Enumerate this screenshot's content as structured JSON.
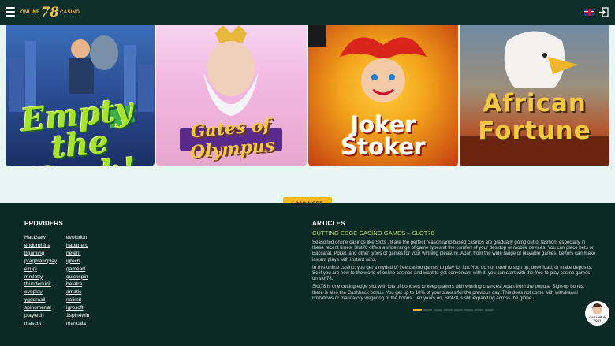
{
  "header": {
    "logo_prefix": "ONLINE",
    "logo_number": "78",
    "logo_suffix": "CASINO"
  },
  "games": [
    {
      "title": "Empty the Bank!"
    },
    {
      "title": "Gates of Olympus"
    },
    {
      "title": "Joker Stoker"
    },
    {
      "title": "African Fortune"
    }
  ],
  "load_more_label": "LOAD MORE",
  "providers": {
    "title": "PROVIDERS",
    "column1": [
      "Hacksaw",
      "endorphina",
      "bgaming",
      "pragmaticplay",
      "ezugi",
      "mrslotty",
      "thunderkick",
      "evoplay",
      "yggdrasil",
      "spinomenal",
      "playtech",
      "mascot"
    ],
    "column2": [
      "evolution",
      "habanero",
      "netent",
      "igtech",
      "gameart",
      "quickspin",
      "belatra",
      "amatic",
      "nolimit",
      "igrosoft",
      "1spin4win",
      "mancala"
    ]
  },
  "articles": {
    "title": "ARTICLES",
    "subtitle": "CUTTING EDGE CASINO GAMES – SLOT78",
    "paragraphs": [
      "Seasoned online casinos like Slots 78 are the perfect reason land-based casinos are gradually going out of fashion, especially in these recent times. Slot78 offers a wide range of game types at the comfort of your desktop or mobile devices. You can place bets on Baccarat, Poker, and other types of games for your winning pleasure. Apart from the wide range of playable games, bettors can make instant plays with instant wins.",
      "In this online casino, you get a myriad of free casino games to play for fun. You do not need to sign up, download, or make deposits. So if you are new to the world of online casinos and want to get conversant with it, you can start with the free-to-play casino games on slot78.",
      "Slot78 is one cutting-edge slot with lots of bonuses to keep players with winning chances. Apart from the popular Sign-up bonus, there is also the Cashback bonus. You get up to 10% of your stakes for the previous day. This does not come with withdrawal limitations or mandatory wagering of the bonus. Ten years on, Slot78 is still expanding across the globe."
    ],
    "slider_count": 8,
    "slider_active": 0
  },
  "help_widget": {
    "label": "CAN I HELP YOU?"
  },
  "colors": {
    "accent": "#f5b719",
    "footer_bg": "#0b2a25",
    "subtitle": "#b9d86b"
  }
}
